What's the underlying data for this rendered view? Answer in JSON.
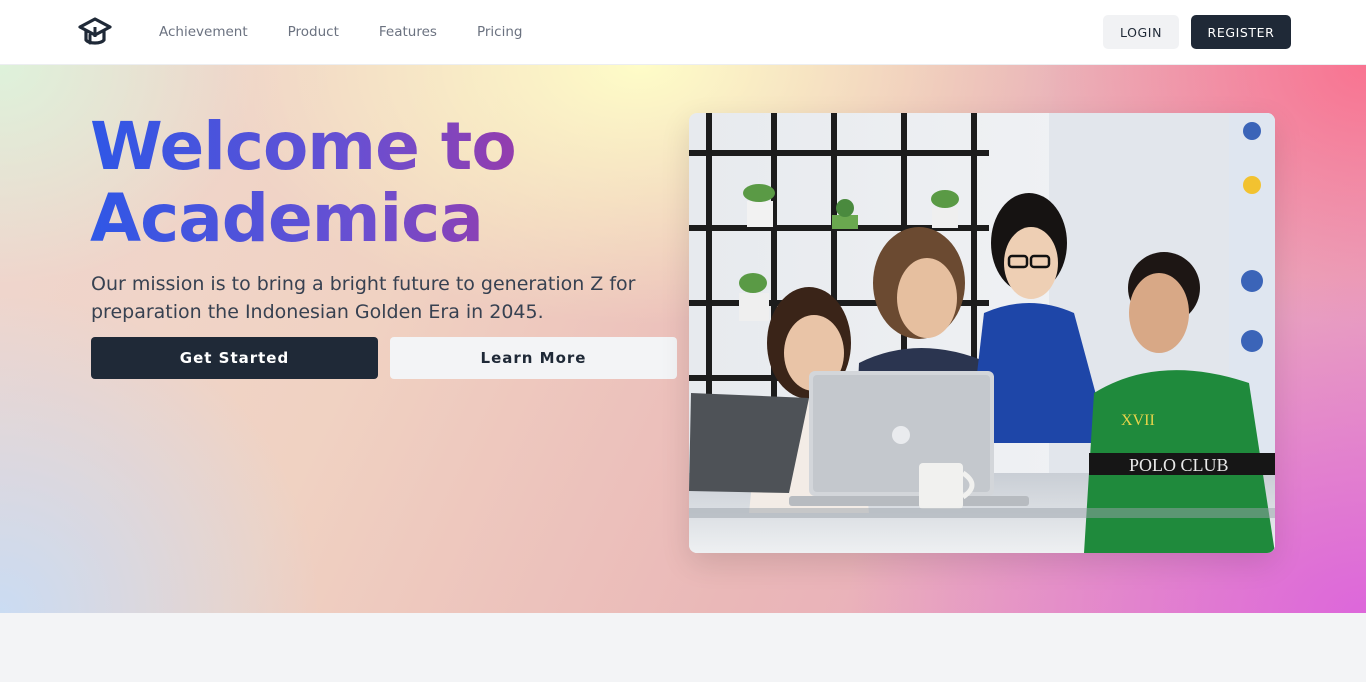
{
  "navbar": {
    "logo_icon": "graduation-cap-icon",
    "links": [
      {
        "label": "Achievement"
      },
      {
        "label": "Product"
      },
      {
        "label": "Features"
      },
      {
        "label": "Pricing"
      }
    ],
    "login_label": "LOGIN",
    "register_label": "REGISTER"
  },
  "hero": {
    "title_line1": "Welcome to",
    "title_line2": "Academica",
    "subtitle": "Our mission is to bring a bright future to generation Z for preparation the Indonesian Golden Era in 2045.",
    "primary_cta": "Get Started",
    "secondary_cta": "Learn More",
    "image_shirt_text": "POLO CLUB",
    "image_badge_text": "XVII"
  },
  "colors": {
    "dark": "#1f2937",
    "title_gradient_start": "#2f57e6",
    "title_gradient_end": "#9a3aa8",
    "nav_text": "#6b7280"
  }
}
